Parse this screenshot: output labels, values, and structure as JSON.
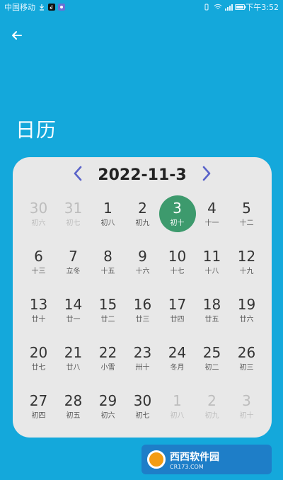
{
  "status_bar": {
    "carrier": "中国移动",
    "time": "下午3:52"
  },
  "header": {
    "title": "日历"
  },
  "calendar": {
    "month_title": "2022-11-3",
    "days": [
      {
        "num": "30",
        "lunar": "初六",
        "other": true
      },
      {
        "num": "31",
        "lunar": "初七",
        "other": true
      },
      {
        "num": "1",
        "lunar": "初八",
        "other": false
      },
      {
        "num": "2",
        "lunar": "初九",
        "other": false
      },
      {
        "num": "3",
        "lunar": "初十",
        "other": false,
        "selected": true
      },
      {
        "num": "4",
        "lunar": "十一",
        "other": false
      },
      {
        "num": "5",
        "lunar": "十二",
        "other": false
      },
      {
        "num": "6",
        "lunar": "十三",
        "other": false
      },
      {
        "num": "7",
        "lunar": "立冬",
        "other": false
      },
      {
        "num": "8",
        "lunar": "十五",
        "other": false
      },
      {
        "num": "9",
        "lunar": "十六",
        "other": false
      },
      {
        "num": "10",
        "lunar": "十七",
        "other": false
      },
      {
        "num": "11",
        "lunar": "十八",
        "other": false
      },
      {
        "num": "12",
        "lunar": "十九",
        "other": false
      },
      {
        "num": "13",
        "lunar": "廿十",
        "other": false
      },
      {
        "num": "14",
        "lunar": "廿一",
        "other": false
      },
      {
        "num": "15",
        "lunar": "廿二",
        "other": false
      },
      {
        "num": "16",
        "lunar": "廿三",
        "other": false
      },
      {
        "num": "17",
        "lunar": "廿四",
        "other": false
      },
      {
        "num": "18",
        "lunar": "廿五",
        "other": false
      },
      {
        "num": "19",
        "lunar": "廿六",
        "other": false
      },
      {
        "num": "20",
        "lunar": "廿七",
        "other": false
      },
      {
        "num": "21",
        "lunar": "廿八",
        "other": false
      },
      {
        "num": "22",
        "lunar": "小雪",
        "other": false
      },
      {
        "num": "23",
        "lunar": "卅十",
        "other": false
      },
      {
        "num": "24",
        "lunar": "冬月",
        "other": false
      },
      {
        "num": "25",
        "lunar": "初二",
        "other": false
      },
      {
        "num": "26",
        "lunar": "初三",
        "other": false
      },
      {
        "num": "27",
        "lunar": "初四",
        "other": false
      },
      {
        "num": "28",
        "lunar": "初五",
        "other": false
      },
      {
        "num": "29",
        "lunar": "初六",
        "other": false
      },
      {
        "num": "30",
        "lunar": "初七",
        "other": false
      },
      {
        "num": "1",
        "lunar": "初八",
        "other": true
      },
      {
        "num": "2",
        "lunar": "初九",
        "other": true
      },
      {
        "num": "3",
        "lunar": "初十",
        "other": true
      }
    ]
  },
  "watermark": {
    "brand": "西西软件园",
    "site": "CR173.COM"
  },
  "colors": {
    "background": "#14a8db",
    "card": "#e8e8e8",
    "selected": "#3d9a6d",
    "nav_arrow": "#5a63c9"
  },
  "icons": {
    "back": "back-arrow-icon",
    "prev": "chevron-left-icon",
    "next": "chevron-right-icon"
  }
}
